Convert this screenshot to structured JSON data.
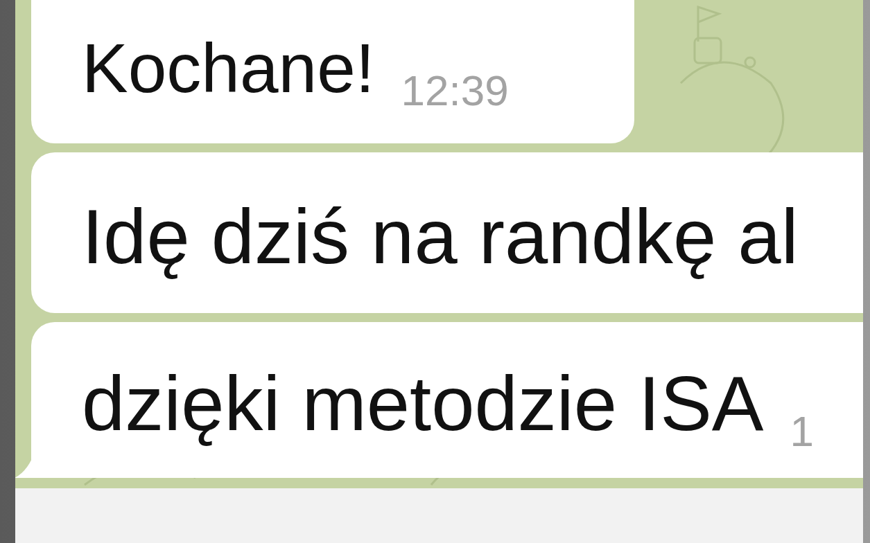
{
  "messages": [
    {
      "text": "Kochane!",
      "time": "12:39",
      "tail": false
    },
    {
      "text": "Idę dziś na randkę al",
      "tail": false
    },
    {
      "text": "dzięki metodzie ISA",
      "time": "1",
      "tail": true
    }
  ]
}
